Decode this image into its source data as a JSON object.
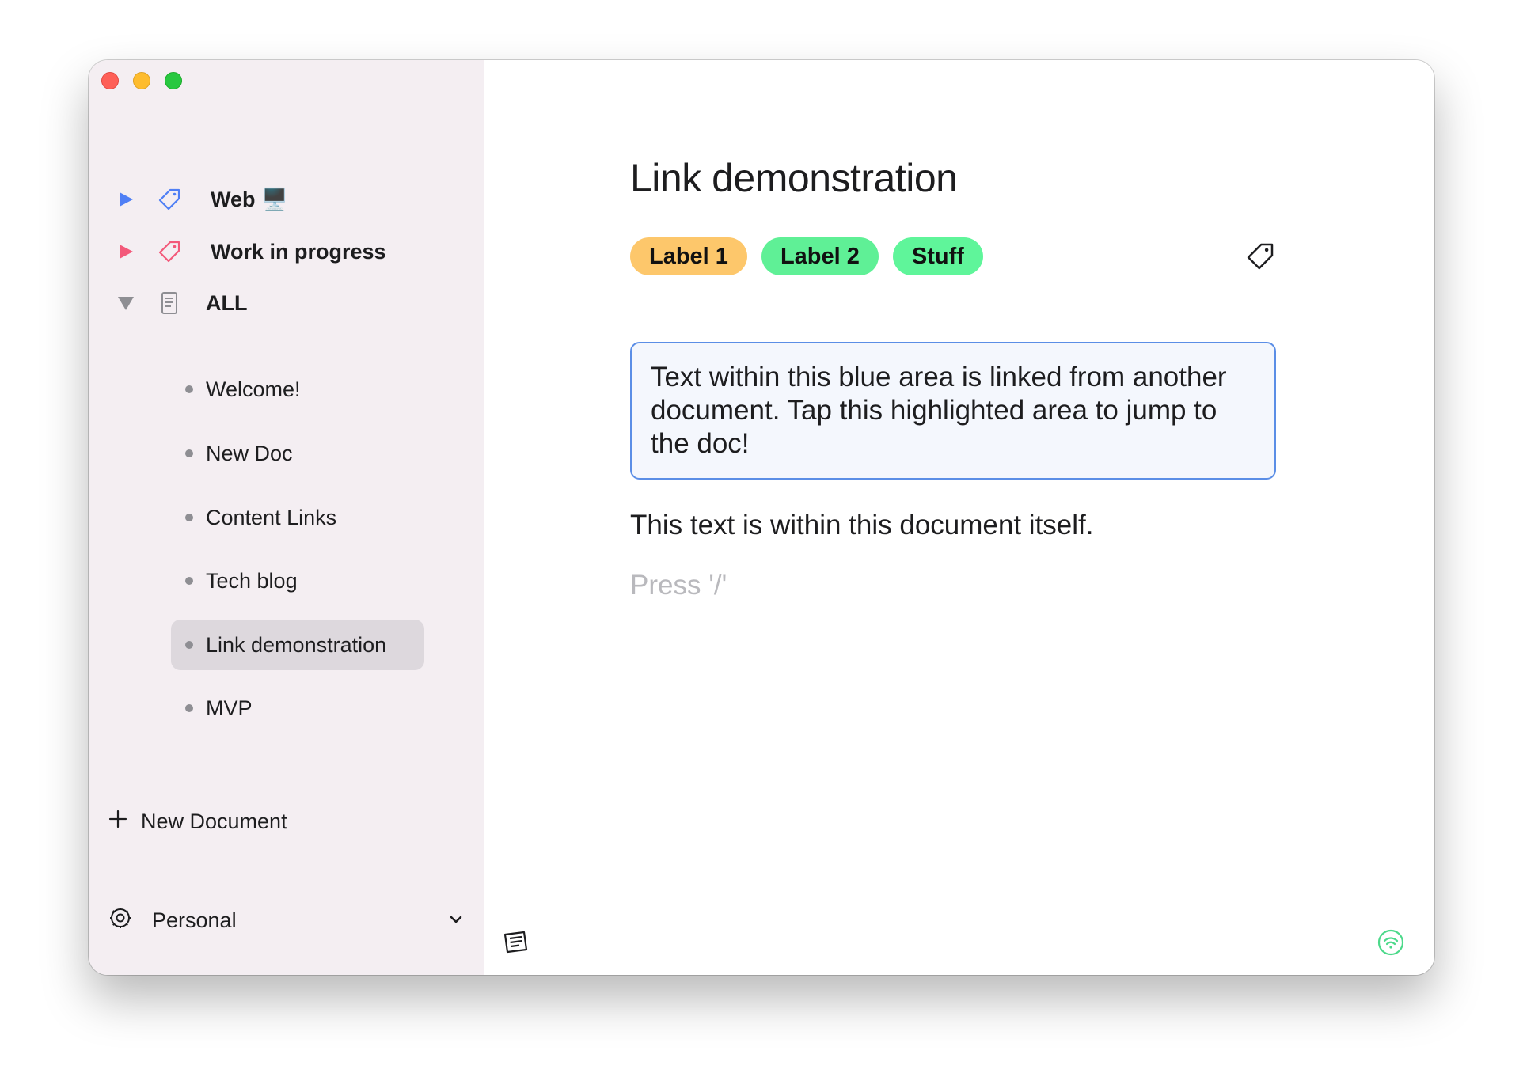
{
  "sidebar": {
    "groups": [
      {
        "label": "Web 🖥️",
        "color": "#4f7ff5",
        "expanded": false,
        "icon": "tag-icon"
      },
      {
        "label": "Work in progress",
        "color": "#f3597a",
        "expanded": false,
        "icon": "tag-icon"
      },
      {
        "label": "ALL",
        "color": "#8e8e93",
        "expanded": true,
        "icon": "document-icon"
      }
    ],
    "documents": [
      {
        "label": "Welcome!",
        "selected": false
      },
      {
        "label": "New Doc",
        "selected": false
      },
      {
        "label": "Content Links",
        "selected": false
      },
      {
        "label": "Tech blog",
        "selected": false
      },
      {
        "label": "Link demonstration",
        "selected": true
      },
      {
        "label": "MVP",
        "selected": false
      }
    ],
    "new_document_label": "New Document",
    "workspace_label": "Personal"
  },
  "document": {
    "title": "Link demonstration",
    "labels": [
      {
        "text": "Label 1",
        "color": "#fdc76b"
      },
      {
        "text": "Label 2",
        "color": "#5ff096"
      },
      {
        "text": "Stuff",
        "color": "#5ff59a"
      }
    ],
    "linked_block_text": "Text within this blue area is linked from another document. Tap this highlighted area to jump to the doc!",
    "paragraph": "This text is within this document itself.",
    "placeholder": "Press '/'"
  },
  "colors": {
    "accent_blue": "#5b8ee6",
    "sync_green": "#4cd98a"
  }
}
